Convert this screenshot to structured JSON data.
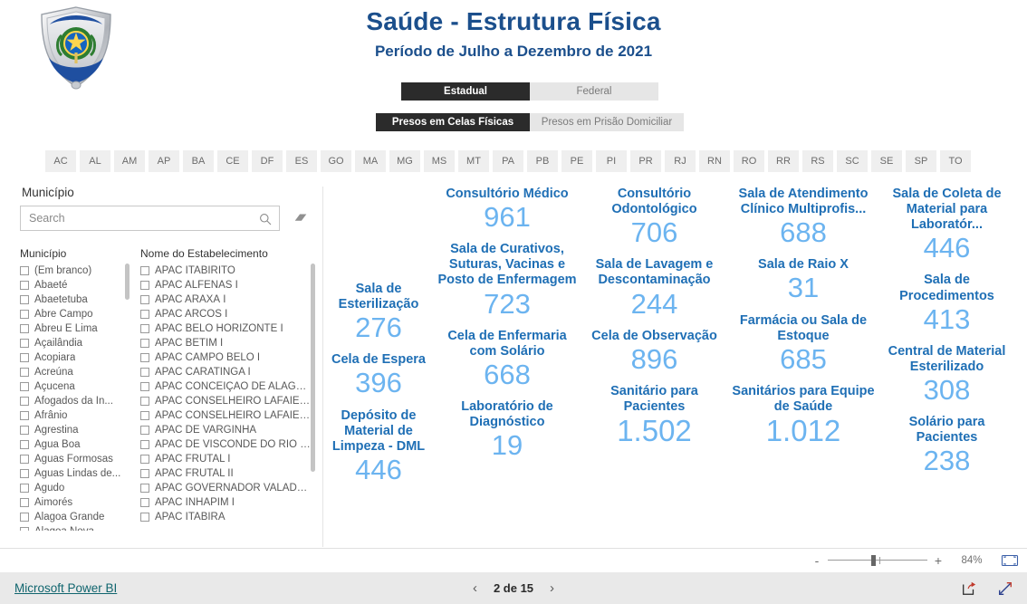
{
  "header": {
    "title": "Saúde - Estrutura Física",
    "subtitle": "Período de Julho a Dezembro de 2021",
    "logo_alt": "depen-shield-logo"
  },
  "toggles": {
    "sphere": {
      "options": [
        {
          "label": "Estadual",
          "selected": true
        },
        {
          "label": "Federal",
          "selected": false
        }
      ]
    },
    "custody": {
      "options": [
        {
          "label": "Presos em Celas Físicas",
          "selected": true
        },
        {
          "label": "Presos em Prisão Domiciliar",
          "selected": false
        }
      ]
    }
  },
  "uf_tabs": [
    "AC",
    "AL",
    "AM",
    "AP",
    "BA",
    "CE",
    "DF",
    "ES",
    "GO",
    "MA",
    "MG",
    "MS",
    "MT",
    "PA",
    "PB",
    "PE",
    "PI",
    "PR",
    "RJ",
    "RN",
    "RO",
    "RR",
    "RS",
    "SC",
    "SE",
    "SP",
    "TO"
  ],
  "slicer": {
    "title": "Município",
    "search": {
      "value": "",
      "placeholder": "Search"
    },
    "search_icon": "search-icon",
    "clear_icon": "eraser-icon",
    "municipio_header": "Município",
    "estabelecimento_header": "Nome do Estabelecimento",
    "municipios": [
      "(Em branco)",
      "Abaeté",
      "Abaetetuba",
      "Abre Campo",
      "Abreu E Lima",
      "Açailândia",
      "Acopiara",
      "Acreúna",
      "Açucena",
      "Afogados da In...",
      "Afrânio",
      "Agrestina",
      "Água Boa",
      "Águas Formosas",
      "Águas Lindas de...",
      "Agudo",
      "Aimorés",
      "Alagoa Grande",
      "Alagoa Nova"
    ],
    "estabelecimentos": [
      "APAC ITABIRITO",
      "APAC ALFENAS I",
      "APAC ARAXÁ I",
      "APAC ARCOS I",
      "APAC BELO HORIZONTE I",
      "APAC BETIM I",
      "APAC CAMPO BELO I",
      "APAC CARATINGA I",
      "APAC CONCEIÇÃO DE ALAGOAS I",
      "APAC CONSELHEIRO LAFAIETE I",
      "APAC CONSELHEIRO LAFAIETE II",
      "APAC DE VARGINHA",
      "APAC DE VISCONDE DO RIO BRA...",
      "APAC FRUTAL I",
      "APAC FRUTAL II",
      "APAC GOVERNADOR VALADARE...",
      "APAC INHAPIM I",
      "APAC ITABIRA"
    ]
  },
  "kpi_columns": [
    {
      "id": "col-1",
      "cards": [
        {
          "label": "Sala de Esterilização",
          "value": "276"
        },
        {
          "label": "Cela de Espera",
          "value": "396"
        },
        {
          "label": "Depósito de Material de Limpeza - DML",
          "value": "446"
        }
      ]
    },
    {
      "id": "col-2",
      "cards": [
        {
          "label": "Consultório Médico",
          "value": "961"
        },
        {
          "label": "Sala de Curativos, Suturas, Vacinas e Posto de Enfermagem",
          "value": "723"
        },
        {
          "label": "Cela de Enfermaria com Solário",
          "value": "668"
        },
        {
          "label": "Laboratório de Diagnóstico",
          "value": "19"
        }
      ]
    },
    {
      "id": "col-3",
      "cards": [
        {
          "label": "Consultório Odontológico",
          "value": "706"
        },
        {
          "label": "Sala de Lavagem e Descontaminação",
          "value": "244"
        },
        {
          "label": "Cela de Observação",
          "value": "896"
        },
        {
          "label": "Sanitário para Pacientes",
          "value": "1.502"
        }
      ]
    },
    {
      "id": "col-4",
      "cards": [
        {
          "label": "Sala de Atendimento Clínico Multiprofis...",
          "value": "688"
        },
        {
          "label": "Sala de Raio X",
          "value": "31"
        },
        {
          "label": "Farmácia ou Sala de Estoque",
          "value": "685"
        },
        {
          "label": "Sanitários para Equipe de Saúde",
          "value": "1.012"
        }
      ]
    },
    {
      "id": "col-5",
      "cards": [
        {
          "label": "Sala de Coleta de Material para Laboratór...",
          "value": "446"
        },
        {
          "label": "Sala de Procedimentos",
          "value": "413"
        },
        {
          "label": "Central de Material Esterilizado",
          "value": "308"
        },
        {
          "label": "Solário para Pacientes",
          "value": "238"
        }
      ]
    }
  ],
  "statusbar": {
    "zoom_out_label": "-",
    "zoom_in_label": "+",
    "zoom_percent": "84%",
    "fit_icon": "fit-to-page-icon"
  },
  "footer": {
    "powerbi_label": "Microsoft Power BI",
    "prev_label": "‹",
    "page_label": "2 de 15",
    "next_label": "›",
    "share_icon": "share-icon",
    "fullscreen_icon": "fullscreen-icon"
  },
  "colors": {
    "title_blue": "#1B4F8C",
    "kpi_label_blue": "#1F6FB5",
    "kpi_value_blue": "#6CB4F0",
    "toggle_selected_bg": "#2B2B2B",
    "toggle_bg": "#E6E6E6",
    "tab_bg": "#EFEFEF",
    "footer_bg": "#E9E9E9",
    "link_teal": "#10656E"
  }
}
